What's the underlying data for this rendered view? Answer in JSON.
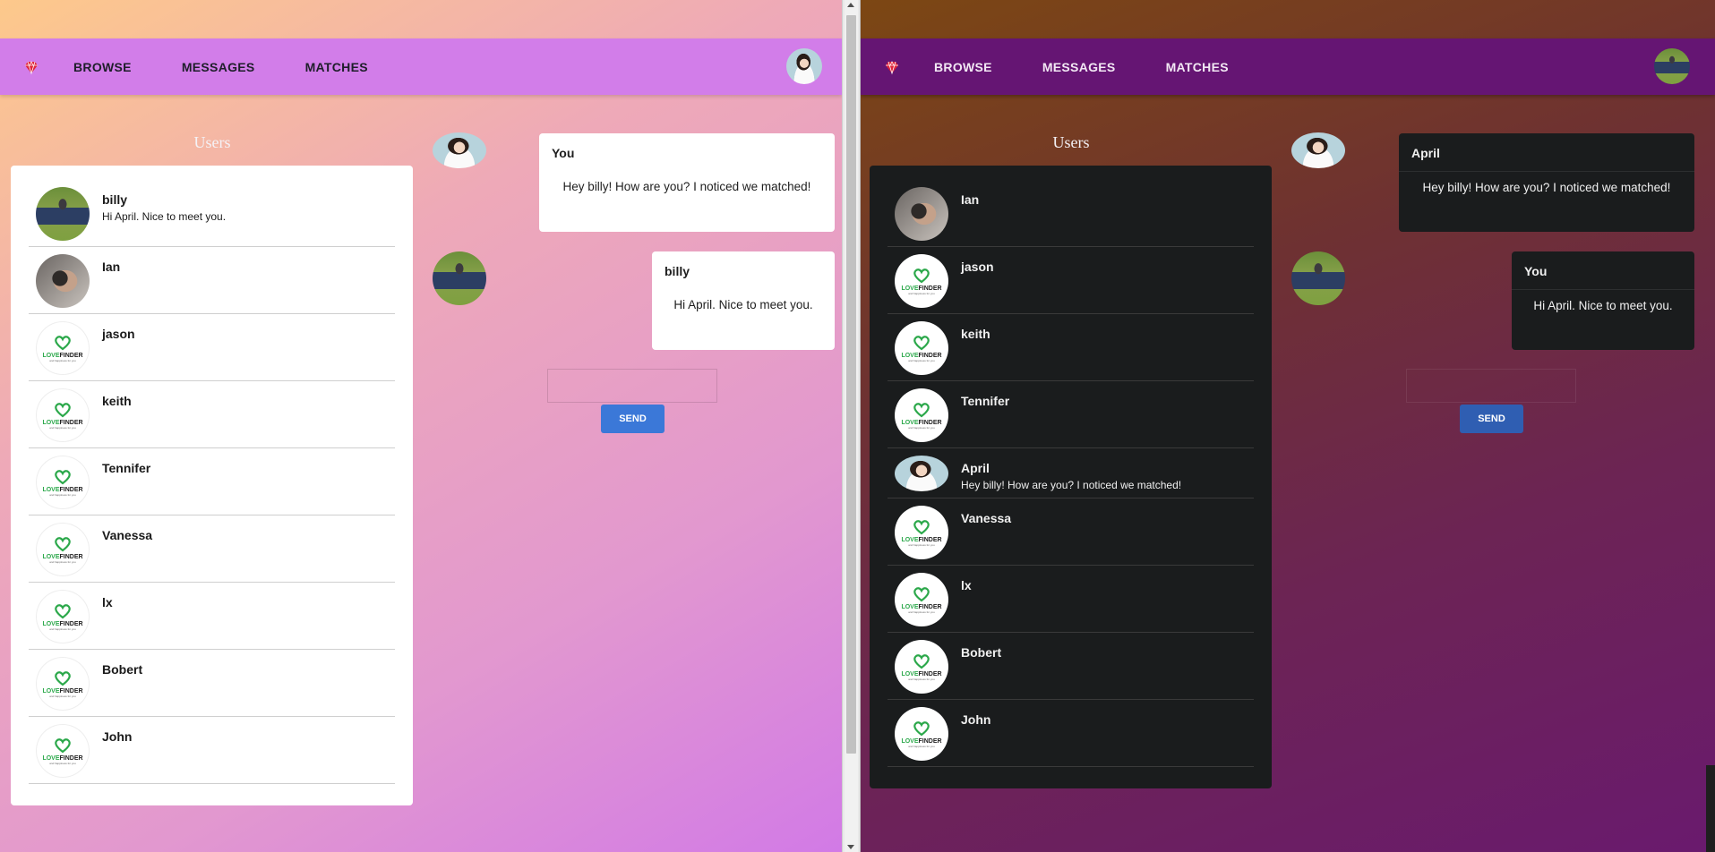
{
  "left": {
    "nav": {
      "links": [
        "BROWSE",
        "MESSAGES",
        "MATCHES"
      ]
    },
    "users_title": "Users",
    "users": [
      {
        "name": "billy",
        "preview": "Hi April. Nice to meet you.",
        "avatar": "billy"
      },
      {
        "name": "Ian",
        "preview": "",
        "avatar": "ian"
      },
      {
        "name": "jason",
        "preview": "",
        "avatar": "lovefinder"
      },
      {
        "name": "keith",
        "preview": "",
        "avatar": "lovefinder"
      },
      {
        "name": "Tennifer",
        "preview": "",
        "avatar": "lovefinder"
      },
      {
        "name": "Vanessa",
        "preview": "",
        "avatar": "lovefinder"
      },
      {
        "name": "lx",
        "preview": "",
        "avatar": "lovefinder"
      },
      {
        "name": "Bobert",
        "preview": "",
        "avatar": "lovefinder"
      },
      {
        "name": "John",
        "preview": "",
        "avatar": "lovefinder"
      }
    ],
    "messages": [
      {
        "sender": "You",
        "text": "Hey billy! How are you? I noticed we matched!"
      },
      {
        "sender": "billy",
        "text": "Hi April. Nice to meet you."
      }
    ],
    "send_label": "SEND"
  },
  "right": {
    "nav": {
      "links": [
        "BROWSE",
        "MESSAGES",
        "MATCHES"
      ]
    },
    "users_title": "Users",
    "users": [
      {
        "name": "Ian",
        "preview": "",
        "avatar": "ian"
      },
      {
        "name": "jason",
        "preview": "",
        "avatar": "lovefinder"
      },
      {
        "name": "keith",
        "preview": "",
        "avatar": "lovefinder"
      },
      {
        "name": "Tennifer",
        "preview": "",
        "avatar": "lovefinder"
      },
      {
        "name": "April",
        "preview": "Hey billy! How are you? I noticed we matched!",
        "avatar": "april"
      },
      {
        "name": "Vanessa",
        "preview": "",
        "avatar": "lovefinder"
      },
      {
        "name": "lx",
        "preview": "",
        "avatar": "lovefinder"
      },
      {
        "name": "Bobert",
        "preview": "",
        "avatar": "lovefinder"
      },
      {
        "name": "John",
        "preview": "",
        "avatar": "lovefinder"
      }
    ],
    "messages": [
      {
        "sender": "April",
        "text": "Hey billy! How are you? I noticed we matched!"
      },
      {
        "sender": "You",
        "text": "Hi April. Nice to meet you."
      }
    ],
    "send_label": "SEND"
  },
  "logo_text": {
    "brand_green": "LOVE",
    "brand_dark": "FINDER",
    "tagline": "and happiness for you"
  },
  "colors": {
    "accent_left": "#d27de9",
    "accent_right": "#651573",
    "send_blue": "#3b78d8",
    "logo_red": "#e0243a",
    "brand_green": "#2ba84a"
  }
}
